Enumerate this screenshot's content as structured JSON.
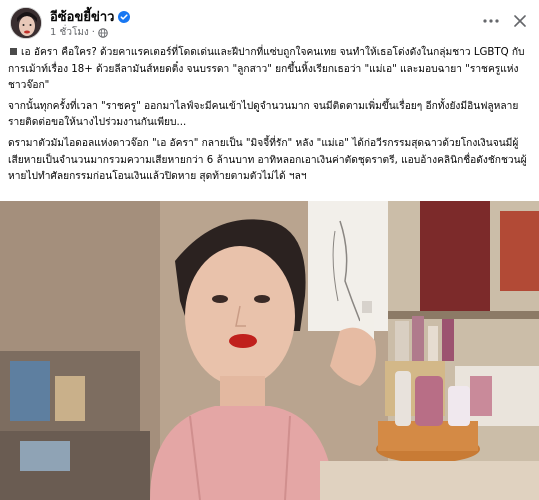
{
  "header": {
    "page_name": "อีซ้อขยี้ข่าว",
    "timestamp": "1 ชั่วโมง",
    "separator": "·",
    "more_icon": "more-horizontal-icon",
    "close_icon": "close-icon",
    "verified_icon": "verified-badge-icon",
    "privacy_icon": "globe-icon"
  },
  "post": {
    "paragraphs": [
      "เอ อัครา คือใคร? ด้วยคาแรคเตอร์ที่โดดเด่นและฝีปากที่แซ่บถูกใจคนเทย จนทำให้เธอโด่งดังในกลุ่มชาว LGBTQ กับการเม้าท์เรื่อง 18+ ด้วยลีลามันส์หยดติ๋ง จนบรรดา \"ลูกสาว\" ยกขึ้นหิ้งเรียกเธอว่า \"แม่เอ\" และมอบฉายา \"ราชครูแห่งชาวจ๊อก\"",
      "จากนั้นทุกครั้งที่เวลา \"ราชครู\" ออกมาไลฟ์จะมีคนเข้าไปดูจำนวนมาก จนมีติดตามเพิ่มขึ้นเรื่อยๆ อีกทั้งยังมีอินฟลูหลายรายติดต่อขอให้นางไปร่วมงานกันเพียบ...",
      "ดรามาตัวมัมไอดอลแห่งดาวจ๊อก \"เอ อัครา\" กลายเป็น \"มิจจี้ที่รัก\" หลัง \"แม่เอ\" ได้ก่อวีรกรรมสุดฉาวด้วยโกงเงินจนมีผู้เสียหายเป็นจำนวนมากรวมความเสียหายกว่า 6 ล้านบาท อาทิหลอกเอาเงินค่าตัดชุดราตรี, แอบอ้างคลินิกชื่อดังชักชวนผู้หายไปทำศัลยกรรมก่อนโอนเงินแล้วปิดหาย สุดท้ายตามตัวไม่ได้ ฯลฯ"
    ],
    "bullet_icon": "square-bullet-icon"
  },
  "colors": {
    "text": "#050505",
    "secondary_text": "#65676b",
    "verified_blue": "#1877f2"
  }
}
